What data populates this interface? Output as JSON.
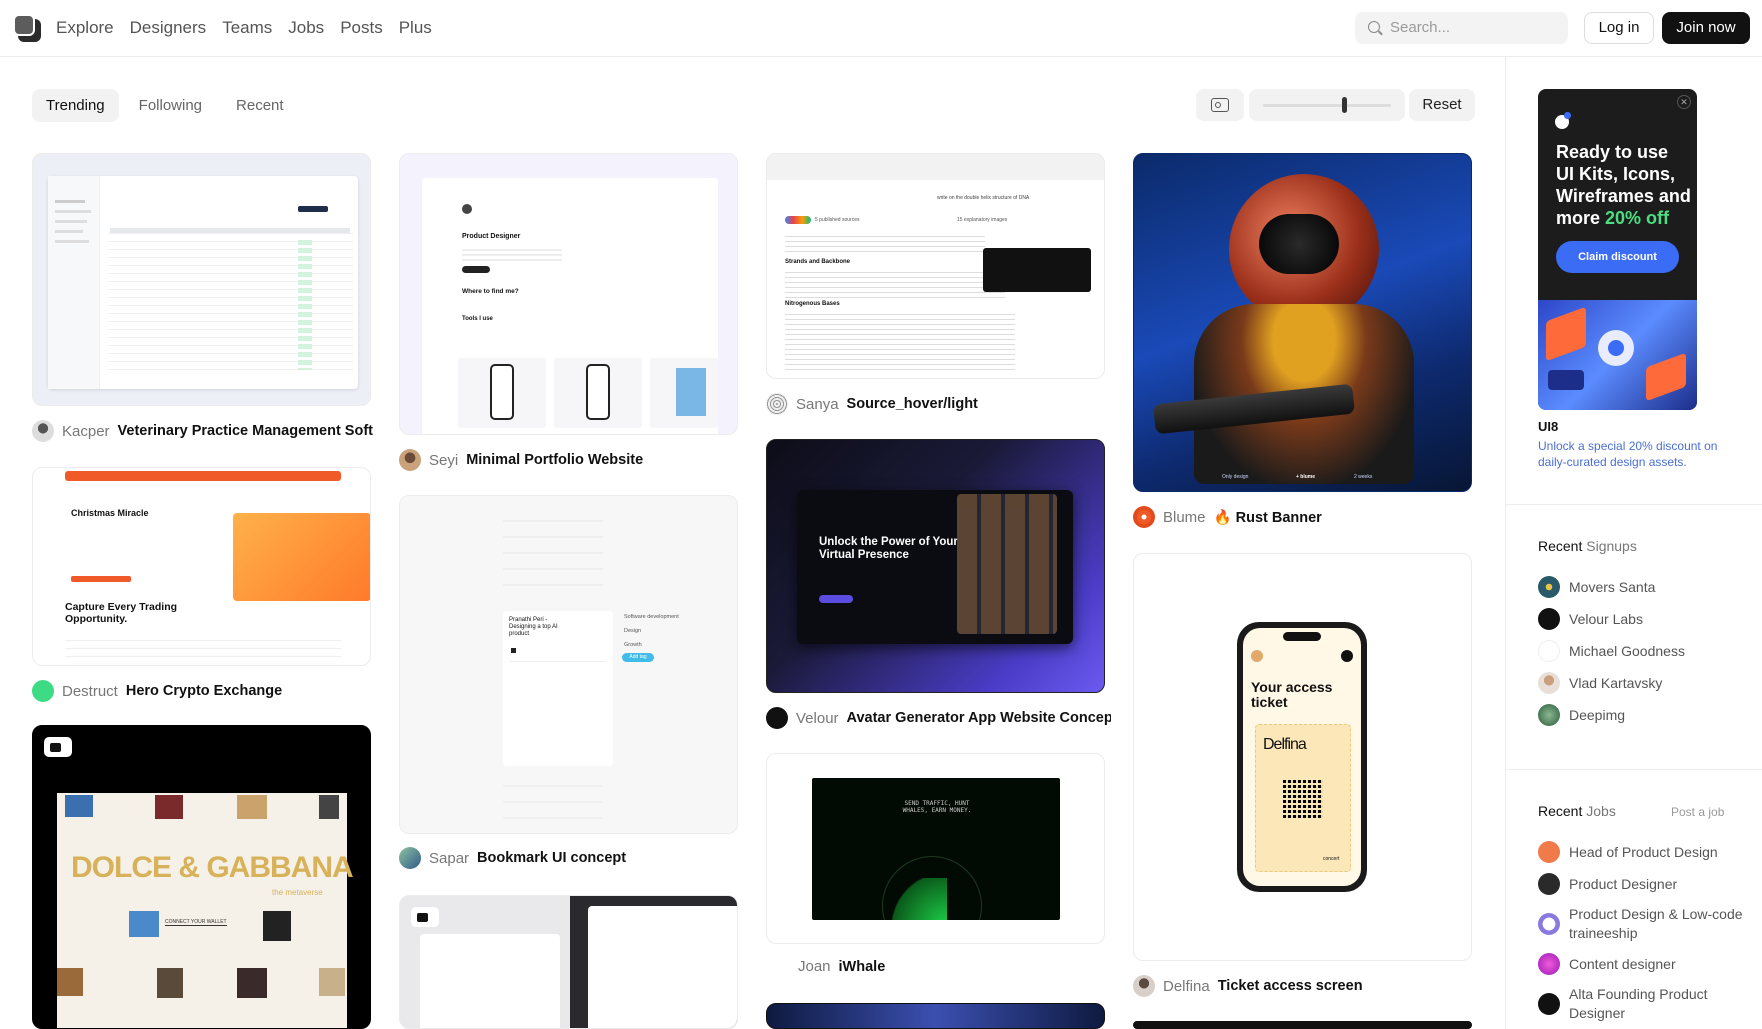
{
  "nav": {
    "items": [
      "Explore",
      "Designers",
      "Teams",
      "Jobs",
      "Posts",
      "Plus"
    ],
    "search_placeholder": "Search...",
    "login": "Log in",
    "join": "Join now"
  },
  "feed_tabs": [
    "Trending",
    "Following",
    "Recent"
  ],
  "view": {
    "reset": "Reset",
    "size_level": 0.62
  },
  "shots": [
    {
      "author": "Kacper",
      "title": "Veterinary Practice Management Soft"
    },
    {
      "author": "Destruct",
      "title": "Hero Crypto Exchange"
    },
    {
      "author": "Seyi",
      "title": "Minimal Portfolio Website"
    },
    {
      "author": "Sapar",
      "title": "Bookmark UI concept"
    },
    {
      "author": "Sanya",
      "title": "Source_hover/light"
    },
    {
      "author": "Velour",
      "title": "Avatar Generator App Website Concep"
    },
    {
      "author": "Joan",
      "title": "iWhale"
    },
    {
      "author": "Blume",
      "title": "🔥 Rust Banner"
    },
    {
      "author": "Delfina",
      "title": "Ticket access screen"
    }
  ],
  "previews": {
    "crypto_heading": "Christmas Miracle",
    "crypto_sub": "Capture Every Trading Opportunity.",
    "dg_text": "DOLCE & GABBANA",
    "dg_sub": "the metaverse",
    "dg_button": "CONNECT YOUR WALLET",
    "portfolio_role": "Product Designer",
    "portfolio_q": "Where to find me?",
    "portfolio_tools": "Tools I use",
    "bookmark_name": "Pranathi Peri - Designing a top AI product",
    "bookmark_tags": [
      "Software development",
      "Design",
      "Growth"
    ],
    "bookmark_add": "Add tag",
    "source_title": "write on the double helix structure of DNA",
    "source_h1": "Strands and Backbone",
    "source_h2": "Nitrogenous Bases",
    "source_chip1": "5 published sources",
    "source_chip2": "15 explanatory images",
    "velour_headline": "Unlock the Power of Your Virtual Presence",
    "iwhale_text": "SEND TRAFFIC, HUNT WHALES, EARN MONEY.",
    "ticket_heading": "Your access ticket",
    "ticket_name": "Delfina",
    "ticket_brand": "concert",
    "rust_labels": [
      "Only design",
      "+ blume",
      "2 weeks"
    ]
  },
  "ad": {
    "headline_white": "Ready to use UI Kits, Icons, Wireframes and more",
    "headline_green": "20% off",
    "cta": "Claim discount",
    "brand": "UI8",
    "subtitle": "Unlock a special 20% discount on daily-curated design assets."
  },
  "signups": {
    "title_bold": "Recent",
    "title_light": "Signups",
    "items": [
      "Movers Santa",
      "Velour Labs",
      "Michael Goodness",
      "Vlad Kartavsky",
      "Deepimg"
    ]
  },
  "jobs": {
    "title_bold": "Recent",
    "title_light": "Jobs",
    "post_link": "Post a job",
    "items": [
      "Head of Product Design",
      "Product Designer",
      "Product Design & Low-code traineeship",
      "Content designer",
      "Alta Founding Product Designer"
    ]
  },
  "colors": {
    "accent": "#3b6cf6",
    "discount_green": "#4ade80",
    "dark": "#111111"
  }
}
